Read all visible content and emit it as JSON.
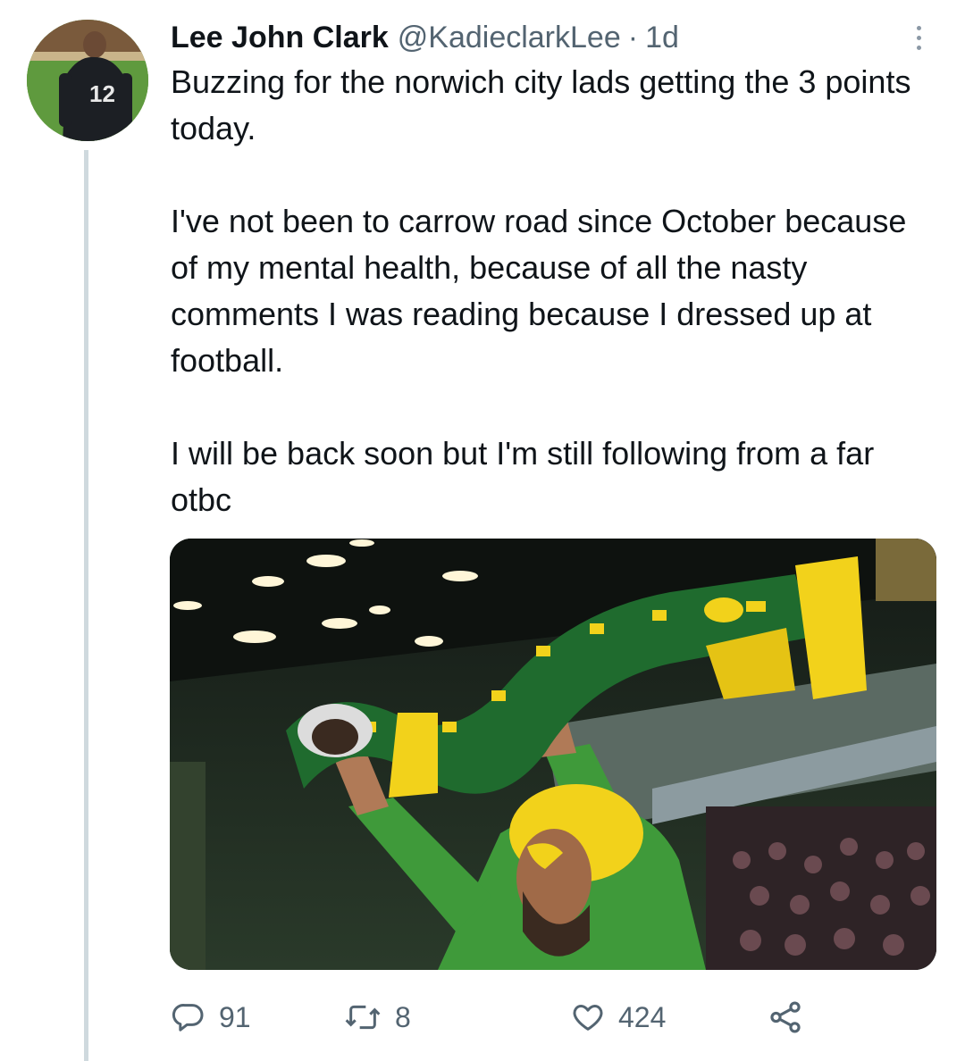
{
  "tweet": {
    "author_name": "Lee John Clark",
    "author_handle": "@KadieclarkLee",
    "separator": "·",
    "time": "1d",
    "avatar_jersey_number": "12",
    "paragraphs": [
      "Buzzing for the norwich city lads getting the 3 points today.",
      "I've not been to carrow road since October because of my mental health, because of all the nasty comments I was reading because I dressed up at football.",
      "I will be back soon but I'm still following from a far otbc"
    ],
    "media": {
      "kind": "photo",
      "colors": {
        "shirt": "#3f9a3a",
        "scarf_green": "#1f6b2e",
        "scarf_yellow": "#f2d21b",
        "stadium": "#1d2620"
      }
    }
  },
  "actions": {
    "reply": {
      "icon": "reply-icon",
      "count": "91"
    },
    "retweet": {
      "icon": "retweet-icon",
      "count": "8"
    },
    "like": {
      "icon": "heart-icon",
      "count": "424"
    },
    "share": {
      "icon": "share-icon"
    }
  },
  "colors": {
    "text_primary": "#0f1419",
    "text_secondary": "#536471",
    "thread_line": "#cfd9de"
  }
}
